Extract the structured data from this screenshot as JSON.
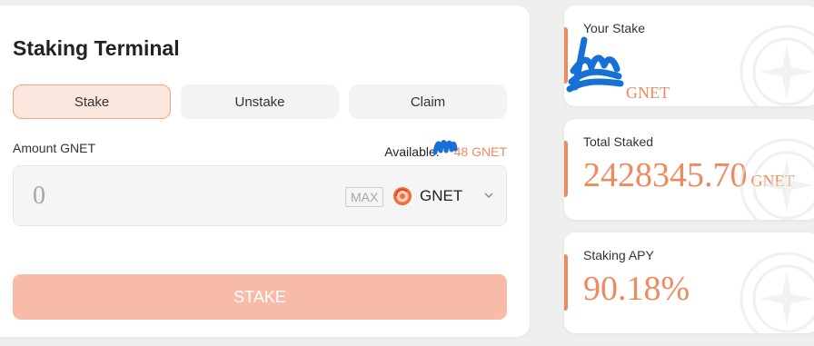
{
  "terminal": {
    "title": "Staking Terminal",
    "tabs": [
      {
        "label": "Stake",
        "active": true
      },
      {
        "label": "Unstake",
        "active": false
      },
      {
        "label": "Claim",
        "active": false
      }
    ],
    "amount_label": "Amount GNET",
    "available_label": "Available:",
    "available_balance": "48 GNET",
    "input_placeholder": "0",
    "max_label": "MAX",
    "token_name": "GNET",
    "token_icon": "gnet-token-icon",
    "stake_button_label": "STAKE"
  },
  "stats": [
    {
      "label": "Your Stake",
      "value": "",
      "unit": "GNET"
    },
    {
      "label": "Total Staked",
      "value": "2428345.70",
      "unit": "GNET"
    },
    {
      "label": "Staking APY",
      "value": "90.18%",
      "unit": ""
    }
  ],
  "colors": {
    "accent": "#ef8a5e",
    "button": "#f7bba8",
    "active_tab_bg": "#f9e6dc",
    "redaction": "#1670d6"
  }
}
